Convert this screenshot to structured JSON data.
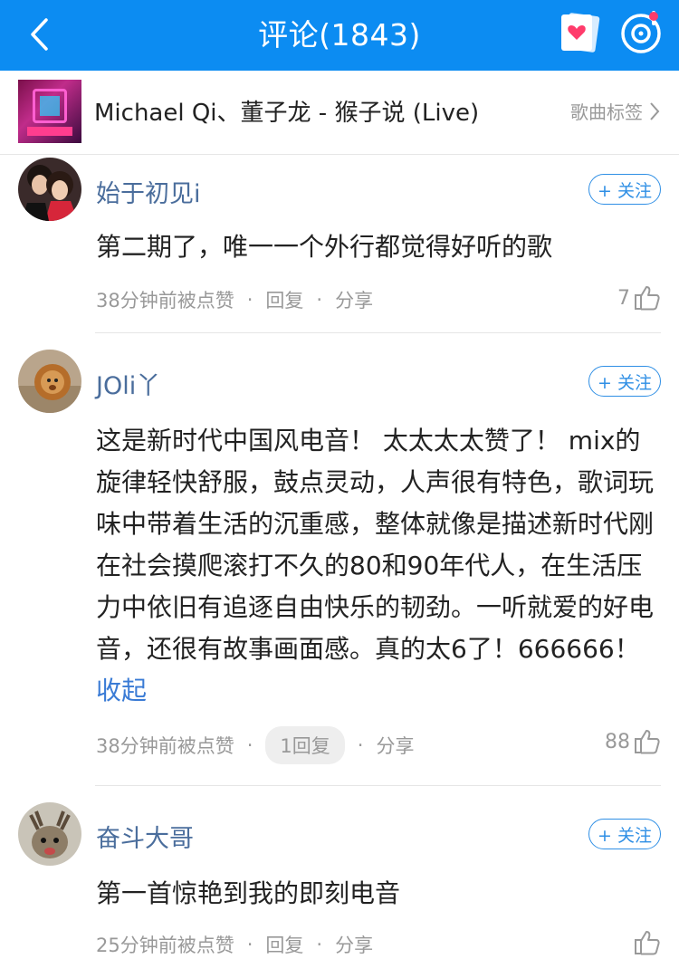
{
  "header": {
    "title": "评论(1843)"
  },
  "song": {
    "title": "Michael Qi、董子龙 - 猴子说 (Live)",
    "tag_label": "歌曲标签"
  },
  "follow_label": "+ 关注",
  "comments": [
    {
      "username": "始于初见i",
      "text": "第二期了，唯一一个外行都觉得好听的歌",
      "time": "38分钟前被点赞",
      "reply": "回复",
      "share": "分享",
      "likes": "7"
    },
    {
      "username": "JOli丫",
      "text": "这是新时代中国风电音！   太太太太赞了！ mix的旋律轻快舒服，鼓点灵动，人声很有特色，歌词玩味中带着生活的沉重感，整体就像是描述新时代刚在社会摸爬滚打不久的80和90年代人，在生活压力中依旧有追逐自由快乐的韧劲。一听就爱的好电音，还很有故事画面感。真的太6了！666666！",
      "collapse": "收起",
      "time": "38分钟前被点赞",
      "reply": "1回复",
      "share": "分享",
      "likes": "88"
    },
    {
      "username": "奋斗大哥",
      "text": "第一首惊艳到我的即刻电音",
      "time": "25分钟前被点赞",
      "reply": "回复",
      "share": "分享",
      "likes": ""
    }
  ],
  "colors": {
    "topbar": "#0c8cf2",
    "username": "#4a6d9c",
    "follow": "#2f8fe5",
    "link": "#3a7bd5"
  }
}
